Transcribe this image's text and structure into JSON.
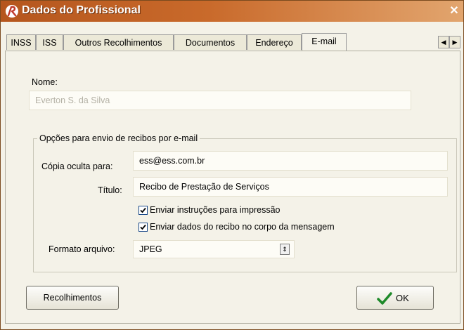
{
  "window": {
    "title": "Dados do Profissional",
    "accent": "#c15f24"
  },
  "tabs": [
    "INSS",
    "ISS",
    "Outros Recolhimentos",
    "Documentos",
    "Endereço",
    "E-mail"
  ],
  "form": {
    "nome_label": "Nome:",
    "nome_value": "Everton S. da Silva",
    "group_title": "Opções para envio de recibos por e-mail",
    "copia_label": "Cópia oculta para:",
    "copia_value": "ess@ess.com.br",
    "titulo_label": "Título:",
    "titulo_value": "Recibo de Prestação de Serviços",
    "check1_label": "Enviar instruções para impressão",
    "check1_checked": true,
    "check2_label": "Enviar dados do recibo no corpo da mensagem",
    "check2_checked": true,
    "formato_label": "Formato arquivo:",
    "formato_value": "JPEG"
  },
  "buttons": {
    "recolhimentos": "Recolhimentos",
    "ok": "OK"
  },
  "icons": {
    "app": "app-logo-icon",
    "close": "close-icon",
    "ok": "checkmark-icon"
  }
}
